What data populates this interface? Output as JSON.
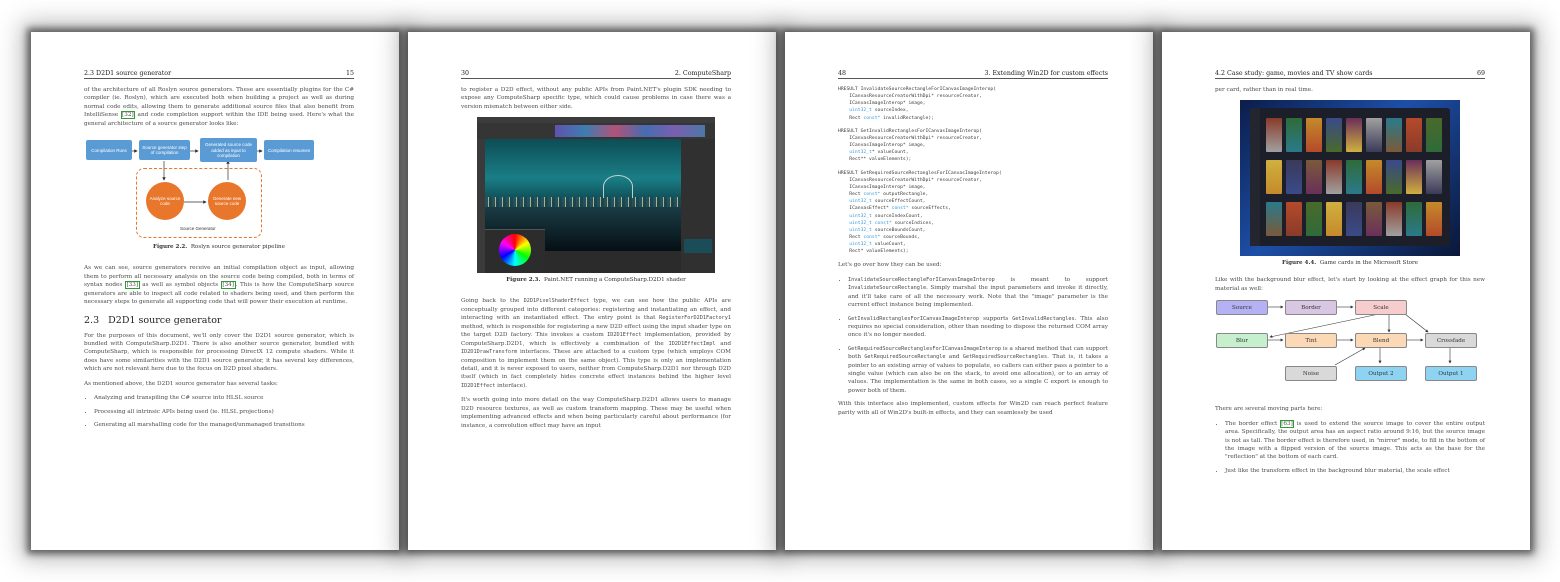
{
  "page1": {
    "header_left": "2.3 D2D1 source generator",
    "header_right": "15",
    "para1_a": "of the architecture of all Roslyn source generators. These are essentially plugins for the C# compiler (ie. Roslyn), which are executed both when building a project as well as during normal code edits, allowing them to generate additional source files that also benefit from IntelliSense ",
    "para1_cite1": "[32]",
    "para1_b": " and code completion support within the IDE being used. Here's what the general architecture of a source generator looks like:",
    "diagram": {
      "compilation_runs": "Compilation Runs",
      "source_generator_step": "Source generator step of compilation",
      "generated_code": "Generated source code added as input to compilation",
      "compilation_resumes": "Compilation resumes",
      "analyze": "Analyze source code",
      "generate": "Generate new source code",
      "source_generator_label": "Source Generator"
    },
    "figure_label": "Figure 2.2.",
    "figure_caption": "Roslyn source generator pipeline",
    "para2_a": "As we can see, source generators receive an initial compilation object as input, allowing them to perform all necessary analysis on the source code being compiled, both in terms of syntax nodes ",
    "para2_cite1": "[33]",
    "para2_b": " as well as symbol objects ",
    "para2_cite2": "[34]",
    "para2_c": ". This is how the ComputeSharp source generators are able to inspect all code related to shaders being used, and then perform the necessary steps to generate all supporting code that will power their execution at runtime.",
    "section_number": "2.3",
    "section_title": "D2D1 source generator",
    "para3": "For the purposes of this document, we'll only cover the D2D1 source generator, which is bundled with ComputeSharp.D2D1. There is also another source generator, bundled with ComputeSharp, which is responsible for processing DirectX 12 compute shaders. While it does have some similarities with the D2D1 source generator, it has several key differences, which are not relevant here due to the focus on D2D pixel shaders.",
    "para4": "As mentioned above, the D2D1 source generator has several tasks:",
    "bullets": [
      "Analyzing and transpiling the C# source into HLSL source",
      "Processing all intrinsic APIs being used (ie. HLSL projections)",
      "Generating all marshalling code for the managed/unmanaged transitions"
    ]
  },
  "page2": {
    "header_left": "30",
    "header_right": "2. ComputeSharp",
    "para1": "to register a D2D effect, without any public APIs from Paint.NET's plugin SDK needing to expose any ComputeSharp specific type, which could cause problems in case there was a version mismatch between either side.",
    "figure_label": "Figure 2.3.",
    "figure_caption": "Paint.NET running a ComputeSharp.D2D1 shader",
    "para2_a": "Going back to the ",
    "para2_code1": "D2D1PixelShaderEffect",
    "para2_b": " type, we can see how the public APIs are conceptually grouped into different categories: registering and instantiating an effect, and interacting with an instantiated effect. The entry point is that ",
    "para2_code2": "RegisterForD2D1Factory1",
    "para2_c": " method, which is responsible for registering a new D2D effect using the input shader type on the target D2D factory. This invokes a custom ",
    "para2_code3": "ID2D1Effect",
    "para2_d": " implementation, provided by ComputeSharp.D2D1, which is effectively a combination of the ",
    "para2_code4": "ID2D1EffectImpl",
    "para2_e": " and ",
    "para2_code5": "ID2D1DrawTransform",
    "para2_f": " interfaces. These are attached to a custom type (which employs COM composition to implement them on the same object). This type is only an implementation detail, and it is never exposed to users, neither from ComputeSharp.D2D1 nor through D2D itself (which in fact completely hides concrete effect instances behind the higher level ",
    "para2_code6": "ID2D1Effect",
    "para2_g": " interface).",
    "para3": "It's worth going into more detail on the way ComputeSharp.D2D1 allows users to manage D2D resource textures, as well as custom transform mapping. These may be useful when implementing advanced effects and when being particularly careful about performance (for instance, a convolution effect may have an input"
  },
  "page3": {
    "header_left": "48",
    "header_right": "3. Extending Win2D for custom effects",
    "code_blocks": [
      [
        {
          "t": "HRESULT InvalidateSourceRectangleForICanvasImageInterop("
        },
        {
          "t": "    ICanvasResourceCreatorWithDpi* resourceCreator,"
        },
        {
          "t": "    ICanvasImageInterop* image,"
        },
        {
          "k": "    uint32_t",
          "t": " sourceIndex,"
        },
        {
          "t": "    Rect ",
          "k2": "const*",
          "t2": " invalidRectangle);"
        }
      ],
      [
        {
          "t": "HRESULT GetInvalidRectanglesForICanvasImageInterop("
        },
        {
          "t": "    ICanvasResourceCreatorWithDpi* resourceCreator,"
        },
        {
          "t": "    ICanvasImageInterop* image,"
        },
        {
          "k": "    uint32_t",
          "t": "* valueCount,"
        },
        {
          "t": "    Rect** valueElements);"
        }
      ],
      [
        {
          "t": "HRESULT GetRequiredSourceRectanglesForICanvasImageInterop("
        },
        {
          "t": "    ICanvasResourceCreatorWithDpi* resourceCreator,"
        },
        {
          "t": "    ICanvasImageInterop* image,"
        },
        {
          "t": "    Rect ",
          "k2": "const*",
          "t2": " outputRectangle,"
        },
        {
          "k": "    uint32_t",
          "t": " sourceEffectCount,"
        },
        {
          "t": "    ICanvasEffect* ",
          "k2": "const*",
          "t2": " sourceEffects,"
        },
        {
          "k": "    uint32_t",
          "t": " sourceIndexCount,"
        },
        {
          "k": "    uint32_t",
          "t": " ",
          "k2": "const*",
          "t2": " sourceIndices,"
        },
        {
          "k": "    uint32_t",
          "t": " sourceBoundsCount,"
        },
        {
          "t": "    Rect ",
          "k2": "const*",
          "t2": " sourceBounds,"
        },
        {
          "k": "    uint32_t",
          "t": " valueCount,"
        },
        {
          "t": "    Rect* valueElements);"
        }
      ]
    ],
    "para1": "Let's go over how they can be used:",
    "b1_code1": "InvalidateSourceRectangleForICanvasImageInterop",
    "b1_a": " is meant to support ",
    "b1_code2": "InvalidateSourceRectangle",
    "b1_b": ". Simply marshal the input parameters and invoke it directly, and it'll take care of all the necessary work. Note that the \"image\" parameter is the current effect instance being implemented.",
    "b2_code1": "GetInvalidRectanglesForICanvasImageInterop",
    "b2_a": " supports ",
    "b2_code2": "GetInvalidRectangles",
    "b2_b": ". This also requires no special consideration, other than needing to dispose the returned COM array once it's no longer needed.",
    "b3_code1": "GetRequiredSourceRectanglesForICanvasImageInterop",
    "b3_a": " is a shared method that can support both ",
    "b3_code2": "GetRequiredSourceRectangle",
    "b3_b": " and ",
    "b3_code3": "GetRequiredSourceRectangles",
    "b3_c": ". That is, it takes a pointer to an existing array of values to populate, so callers can either pass a pointer to a single value (which can also be on the stack, to avoid one allocation), or to an array of values. The implementation is the same in both cases, so a single C export is enough to power both of them.",
    "para2": "With this interface also implemented, custom effects for Win2D can reach perfect feature parity with all of Win2D's built-in effects, and they can seamlessly be used"
  },
  "page4": {
    "header_left": "4.2 Case study: game, movies and TV show cards",
    "header_right": "69",
    "para1": "per card, rather than in real time.",
    "figure_label": "Figure 4.4.",
    "figure_caption": "Game cards in the Microsoft Store",
    "para2": "Like with the background blur effect, let's start by looking at the effect graph for this new material as well:",
    "graph": {
      "source": "Source",
      "border": "Border",
      "scale": "Scale",
      "blur": "Blur",
      "tint": "Tint",
      "blend": "Blend",
      "crossfade": "Crossfade",
      "noise": "Noise",
      "output2": "Output 2",
      "output1": "Output 1"
    },
    "para3": "There are several moving parts here:",
    "b1_a": "The border effect ",
    "b1_cite": "[63]",
    "b1_b": " is used to extend the source image to cover the entire output area. Specifically, the output area has an aspect ratio around 9:16, but the source image is not as tall. The border effect is therefore used, in \"mirror\" mode, to fill in the bottom of the image with a flipped version of the source image. This acts as the base for the \"reflection\" at the bottom of each card.",
    "b2": "Just like the transform effect in the background blur material, the scale effect"
  },
  "colors": {
    "diagram_blue": "#5b9bd5",
    "diagram_orange": "#e8762b",
    "node_purple": "#b4b2f5",
    "node_lilac": "#d9c6e3",
    "node_pink": "#f6cccc",
    "node_green": "#c6efce",
    "node_peach": "#fcd9b6",
    "node_gray": "#d9d9d9",
    "node_blue": "#8fd3f2"
  }
}
